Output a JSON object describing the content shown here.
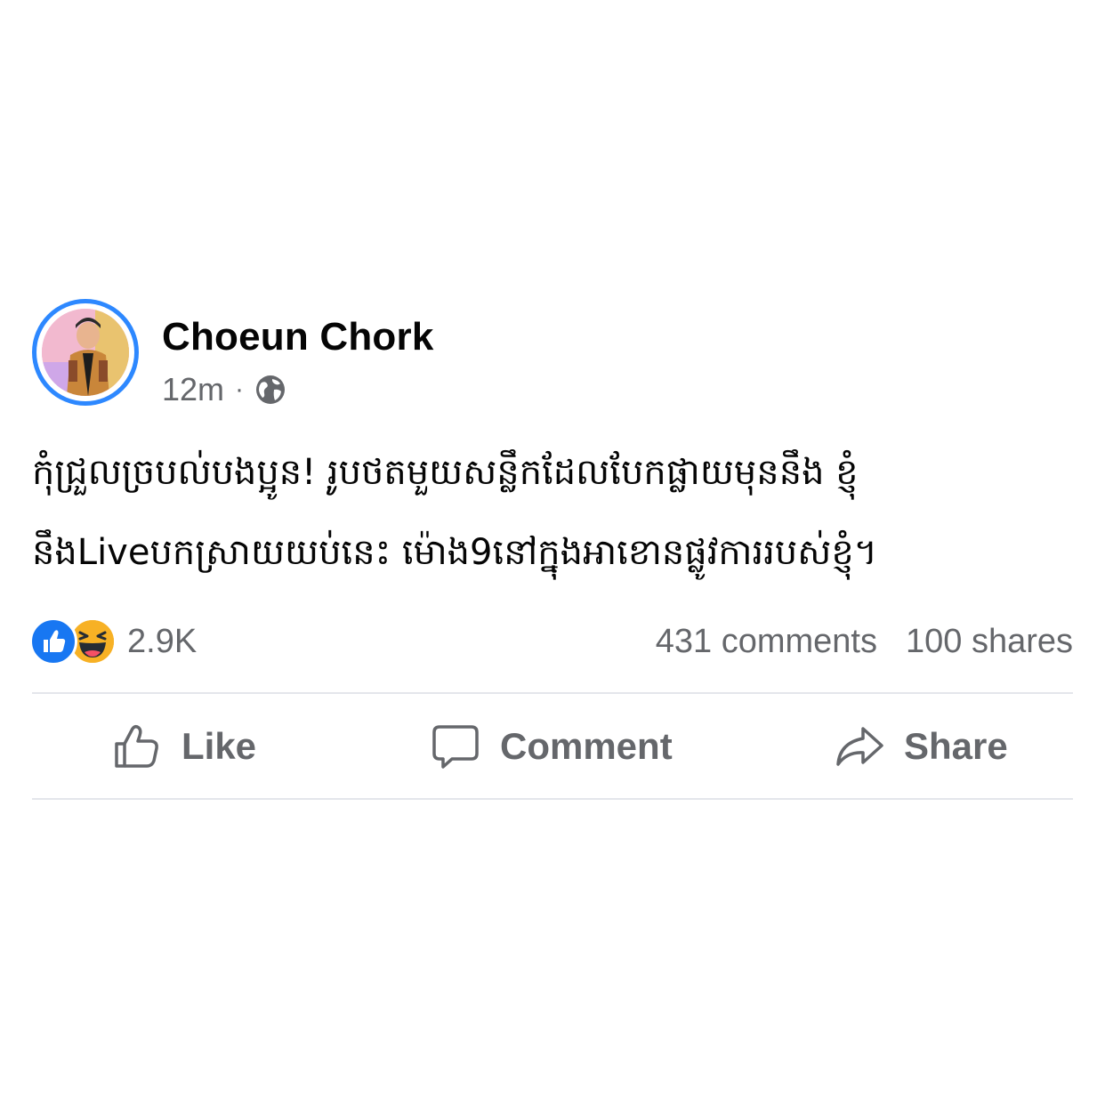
{
  "post": {
    "author": "Choeun Chork",
    "time": "12m",
    "separator": "·",
    "audience_icon": "globe-icon",
    "text_lines": [
      "កុំជ្រួលច្របល់បងប្អូន! រូបថតមួយសន្លឹកដែលបែកផ្លាយមុននឹង ខ្ញុំ",
      "នឹងLiveបកស្រាយយប់នេះ ម៉ោង9នៅក្នុងអាខោនផ្លូវការរបស់ខ្ញុំ។"
    ]
  },
  "stats": {
    "reaction_icons": [
      "like-icon",
      "haha-icon"
    ],
    "reaction_count": "2.9K",
    "comments": "431 comments",
    "shares": "100 shares"
  },
  "actions": {
    "like_label": "Like",
    "comment_label": "Comment",
    "share_label": "Share"
  },
  "colors": {
    "avatar_ring": "#2d88ff",
    "like_blue": "#1877f2",
    "haha_yellow": "#f7b125",
    "secondary_text": "#65676b",
    "divider": "#e4e6eb"
  }
}
